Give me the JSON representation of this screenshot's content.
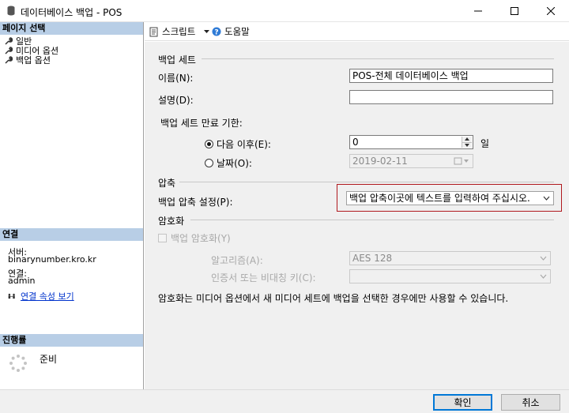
{
  "window": {
    "title": "데이터베이스 백업 - POS"
  },
  "sidebar": {
    "page_select_header": "페이지 선택",
    "pages": [
      {
        "label": "일반"
      },
      {
        "label": "미디어 옵션"
      },
      {
        "label": "백업 옵션"
      }
    ],
    "connection_header": "연결",
    "server_label": "서버:",
    "server_value": "binarynumber.kro.kr",
    "connection_label": "연결:",
    "connection_value": "admin",
    "view_connection_link": "연결 속성 보기",
    "progress_header": "진행률",
    "progress_status": "준비"
  },
  "toolbar": {
    "script_label": "스크립트",
    "help_label": "도움말"
  },
  "backup_set": {
    "section_title": "백업 세트",
    "name_label": "이름(N):",
    "name_value": "POS-전체 데이터베이스 백업",
    "description_label": "설명(D):",
    "description_value": "",
    "expiry_label": "백업 세트 만료 기한:",
    "after_label": "다음 이후(E):",
    "after_value": "0",
    "days_unit": "일",
    "on_label": "날짜(O):",
    "on_value": "2019-02-11"
  },
  "compression": {
    "section_title": "압축",
    "setting_label": "백업 압축 설정(P):",
    "setting_value": "백업 압축이곳에 텍스트를 입력하여 주십시오."
  },
  "encryption": {
    "section_title": "암호화",
    "encrypt_checkbox_label": "백업 암호화(Y)",
    "algorithm_label": "알고리즘(A):",
    "algorithm_value": "AES 128",
    "certificate_label": "인증서 또는 비대칭 키(C):",
    "certificate_value": "",
    "note": "암호화는 미디어 옵션에서 새 미디어 세트에 백업을 선택한 경우에만 사용할 수 있습니다."
  },
  "footer": {
    "ok_label": "확인",
    "cancel_label": "취소"
  },
  "colors": {
    "sidebar_header_bg": "#b8cee6",
    "link": "#0033cc",
    "highlight_border": "#b0191e"
  }
}
